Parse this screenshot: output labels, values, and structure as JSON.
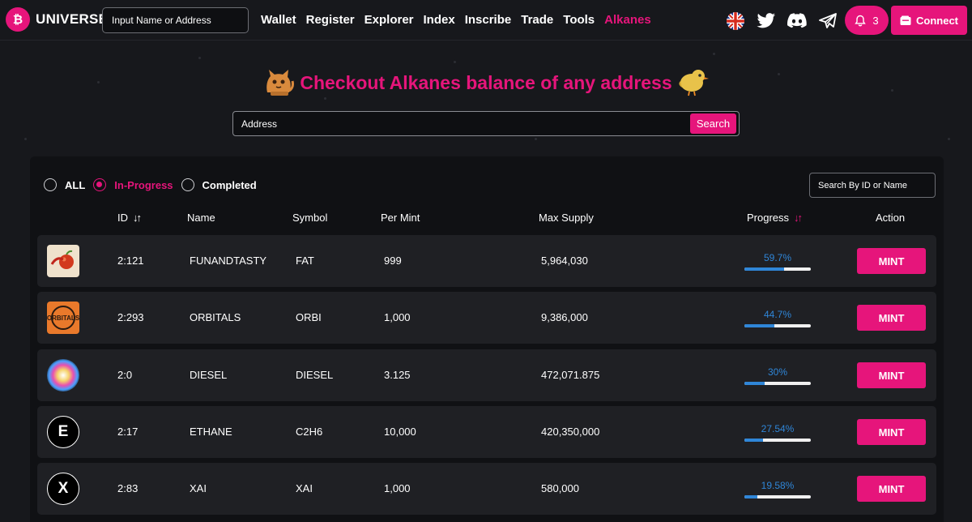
{
  "header": {
    "brand": "UNIVERSE",
    "search_placeholder": "Input Name or Address",
    "nav": [
      "Wallet",
      "Register",
      "Explorer",
      "Index",
      "Inscribe",
      "Trade",
      "Tools",
      "Alkanes"
    ],
    "active_nav": "Alkanes",
    "icons": [
      "uk-flag-icon",
      "twitter-icon",
      "discord-icon",
      "telegram-icon"
    ],
    "notification_count": "3",
    "connect_label": "Connect"
  },
  "hero": {
    "title": "Checkout Alkanes balance of any address",
    "address_placeholder": "Address",
    "search_label": "Search"
  },
  "filters": {
    "all": "ALL",
    "in_progress": "In-Progress",
    "completed": "Completed",
    "selected": "In-Progress",
    "search_placeholder": "Search By ID or Name"
  },
  "table": {
    "columns": {
      "id": "ID",
      "name": "Name",
      "symbol": "Symbol",
      "per_mint": "Per Mint",
      "max_supply": "Max Supply",
      "progress": "Progress",
      "action": "Action"
    },
    "rows": [
      {
        "id": "2:121",
        "name": "FUNANDTASTY",
        "symbol": "FAT",
        "per_mint": "999",
        "max_supply": "5,964,030",
        "progress_text": "59.7%",
        "progress": 59.7,
        "action": "MINT"
      },
      {
        "id": "2:293",
        "name": "ORBITALS",
        "symbol": "ORBI",
        "per_mint": "1,000",
        "max_supply": "9,386,000",
        "progress_text": "44.7%",
        "progress": 44.7,
        "action": "MINT",
        "logo_text": "ORBITALS"
      },
      {
        "id": "2:0",
        "name": "DIESEL",
        "symbol": "DIESEL",
        "per_mint": "3.125",
        "max_supply": "472,071.875",
        "progress_text": "30%",
        "progress": 30,
        "action": "MINT"
      },
      {
        "id": "2:17",
        "name": "ETHANE",
        "symbol": "C2H6",
        "per_mint": "10,000",
        "max_supply": "420,350,000",
        "progress_text": "27.54%",
        "progress": 27.54,
        "action": "MINT",
        "logo_text": "E"
      },
      {
        "id": "2:83",
        "name": "XAI",
        "symbol": "XAI",
        "per_mint": "1,000",
        "max_supply": "580,000",
        "progress_text": "19.58%",
        "progress": 19.58,
        "action": "MINT",
        "logo_text": "X"
      }
    ]
  },
  "colors": {
    "accent": "#e6157b",
    "progress": "#2f86d8",
    "background": "#17181c",
    "row": "#1f2024"
  }
}
